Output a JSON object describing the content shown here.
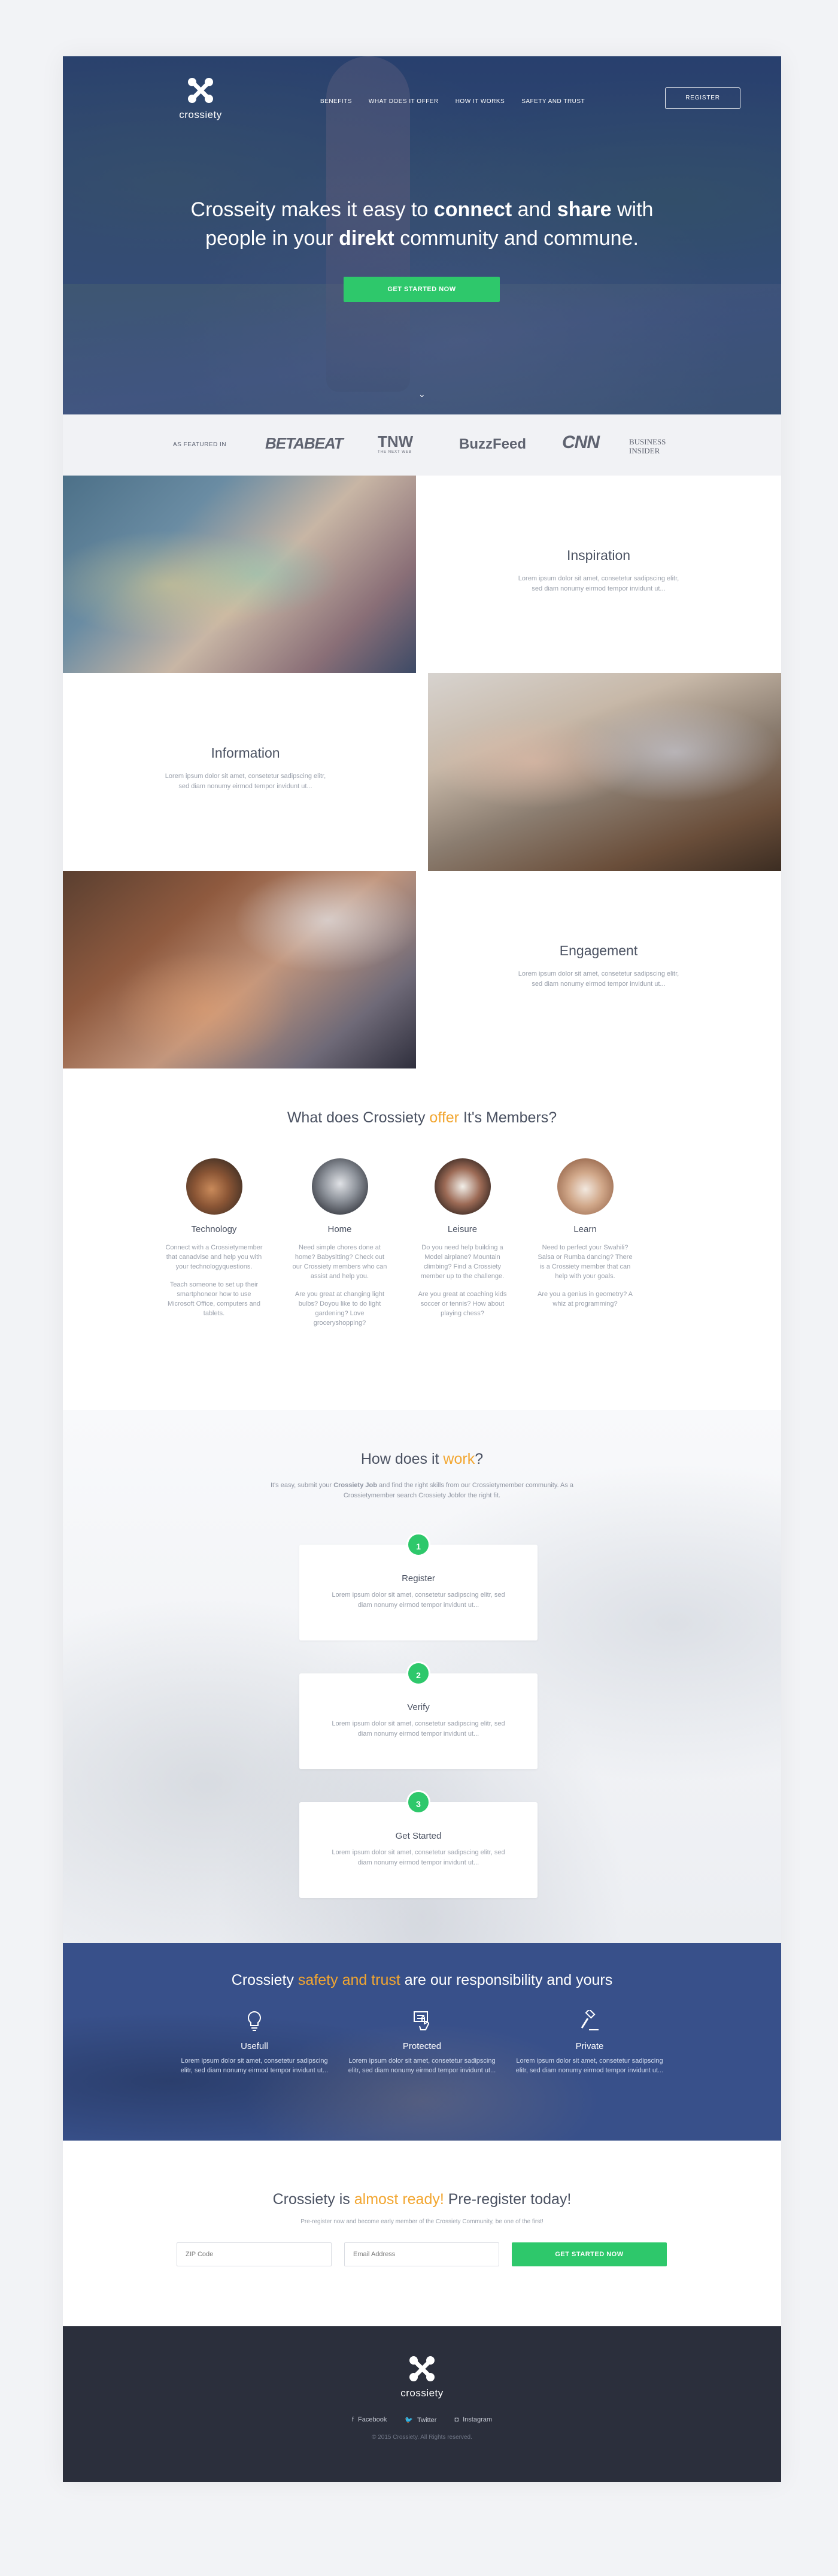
{
  "brand": {
    "name": "crossiety"
  },
  "nav": {
    "items": [
      "Benefits",
      "What does it offer",
      "How it works",
      "Safety and trust"
    ],
    "register": "Register"
  },
  "hero": {
    "line1_pre": "Crosseity makes it easy to ",
    "line1_b1": "connect",
    "line1_mid": " and ",
    "line1_b2": "share",
    "line1_post": " with",
    "line2_pre": "people in your ",
    "line2_b": "direkt",
    "line2_post": " community and commune.",
    "cta": "Get started now",
    "chevron": "⌄"
  },
  "featured": {
    "label": "As featured in",
    "logos": {
      "betabeat": "BETABEAT",
      "tnw": "TNW",
      "tnw_sub": "THE NEXT WEB",
      "buzzfeed": "BuzzFeed",
      "cnn": "CNN",
      "bi_1": "BUSINESS",
      "bi_2": "INSIDER"
    }
  },
  "features": [
    {
      "title": "Inspiration",
      "text": "Lorem ipsum dolor sit amet, consetetur sadipscing elitr, sed diam nonumy eirmod tempor invidunt ut..."
    },
    {
      "title": "Information",
      "text": "Lorem ipsum dolor sit amet, consetetur sadipscing elitr, sed diam nonumy eirmod tempor invidunt ut..."
    },
    {
      "title": "Engagement",
      "text": "Lorem ipsum dolor sit amet, consetetur sadipscing elitr, sed diam nonumy eirmod tempor invidunt ut..."
    }
  ],
  "offer": {
    "title_pre": "What does Crossiety ",
    "title_accent": "offer",
    "title_post": " It's Members?",
    "items": [
      {
        "title": "Technology",
        "p1": "Connect with a Crossietymember that canadvise and help you with your technologyquestions.",
        "p2": "Teach someone to set up their smartphoneor how to use Microsoft Office, computers and tablets."
      },
      {
        "title": "Home",
        "p1": "Need simple chores done at home? Babysitting? Check out our Crossiety members who can assist and help you.",
        "p2": "Are you great at changing light bulbs? Doyou like to do light gardening? Love groceryshopping?"
      },
      {
        "title": "Leisure",
        "p1": "Do you need help building a Model airplane? Mountain climbing? Find a Crossiety member up to the challenge.",
        "p2": "Are you great at coaching kids soccer or tennis? How about playing chess?"
      },
      {
        "title": "Learn",
        "p1": "Need to perfect your Swahili? Salsa or Rumba dancing? There is a Crossiety member that can help with your goals.",
        "p2": "Are you a genius in geometry? A whiz at programming?"
      }
    ]
  },
  "how": {
    "title_pre": "How does it ",
    "title_accent": "work",
    "title_post": "?",
    "sub_pre": "It's easy, submit your ",
    "sub_b": "Crossiety Job",
    "sub_post": " and find the right skills from our Crossietymember community. As a Crossietymember search Crossiety Jobfor the right fit.",
    "steps": [
      {
        "num": "1",
        "title": "Register",
        "text": "Lorem ipsum dolor sit amet, consetetur sadipscing elitr, sed diam nonumy eirmod tempor invidunt ut..."
      },
      {
        "num": "2",
        "title": "Verify",
        "text": "Lorem ipsum dolor sit amet, consetetur sadipscing elitr, sed diam nonumy eirmod tempor invidunt ut..."
      },
      {
        "num": "3",
        "title": "Get Started",
        "text": "Lorem ipsum dolor sit amet, consetetur sadipscing elitr, sed diam nonumy eirmod tempor invidunt ut..."
      }
    ]
  },
  "safety": {
    "title_pre": "Crossiety ",
    "title_accent": "safety and trust",
    "title_post": " are our responsibility and yours",
    "items": [
      {
        "icon": "lightbulb-icon",
        "title": "Usefull",
        "text": "Lorem ipsum dolor sit amet, consetetur sadipscing elitr, sed diam nonumy eirmod tempor invidunt ut..."
      },
      {
        "icon": "hand-tap-icon",
        "title": "Protected",
        "text": "Lorem ipsum dolor sit amet, consetetur sadipscing elitr, sed diam nonumy eirmod tempor invidunt ut..."
      },
      {
        "icon": "gavel-icon",
        "title": "Private",
        "text": "Lorem ipsum dolor sit amet, consetetur sadipscing elitr, sed diam nonumy eirmod tempor invidunt ut..."
      }
    ]
  },
  "prereg": {
    "title_pre": "Crossiety is ",
    "title_accent": "almost ready!",
    "title_post": " Pre-register today!",
    "sub": "Pre-register now and become early member of the Crossiety Community, be one of the first!",
    "zip_placeholder": "ZIP Code",
    "email_placeholder": "Email Address",
    "cta": "Get started now"
  },
  "footer": {
    "social": [
      {
        "icon": "facebook-icon",
        "glyph": "f",
        "label": "Facebook"
      },
      {
        "icon": "twitter-icon",
        "glyph": "🐦",
        "label": "Twitter"
      },
      {
        "icon": "instagram-icon",
        "glyph": "◘",
        "label": "Instagram"
      }
    ],
    "copyright": "© 2015 Crossiety. All Rights reserved."
  },
  "colors": {
    "accent": "#f2a630",
    "green": "#2ec86b",
    "navy": "#38508a",
    "footer": "#2b2f3c"
  }
}
